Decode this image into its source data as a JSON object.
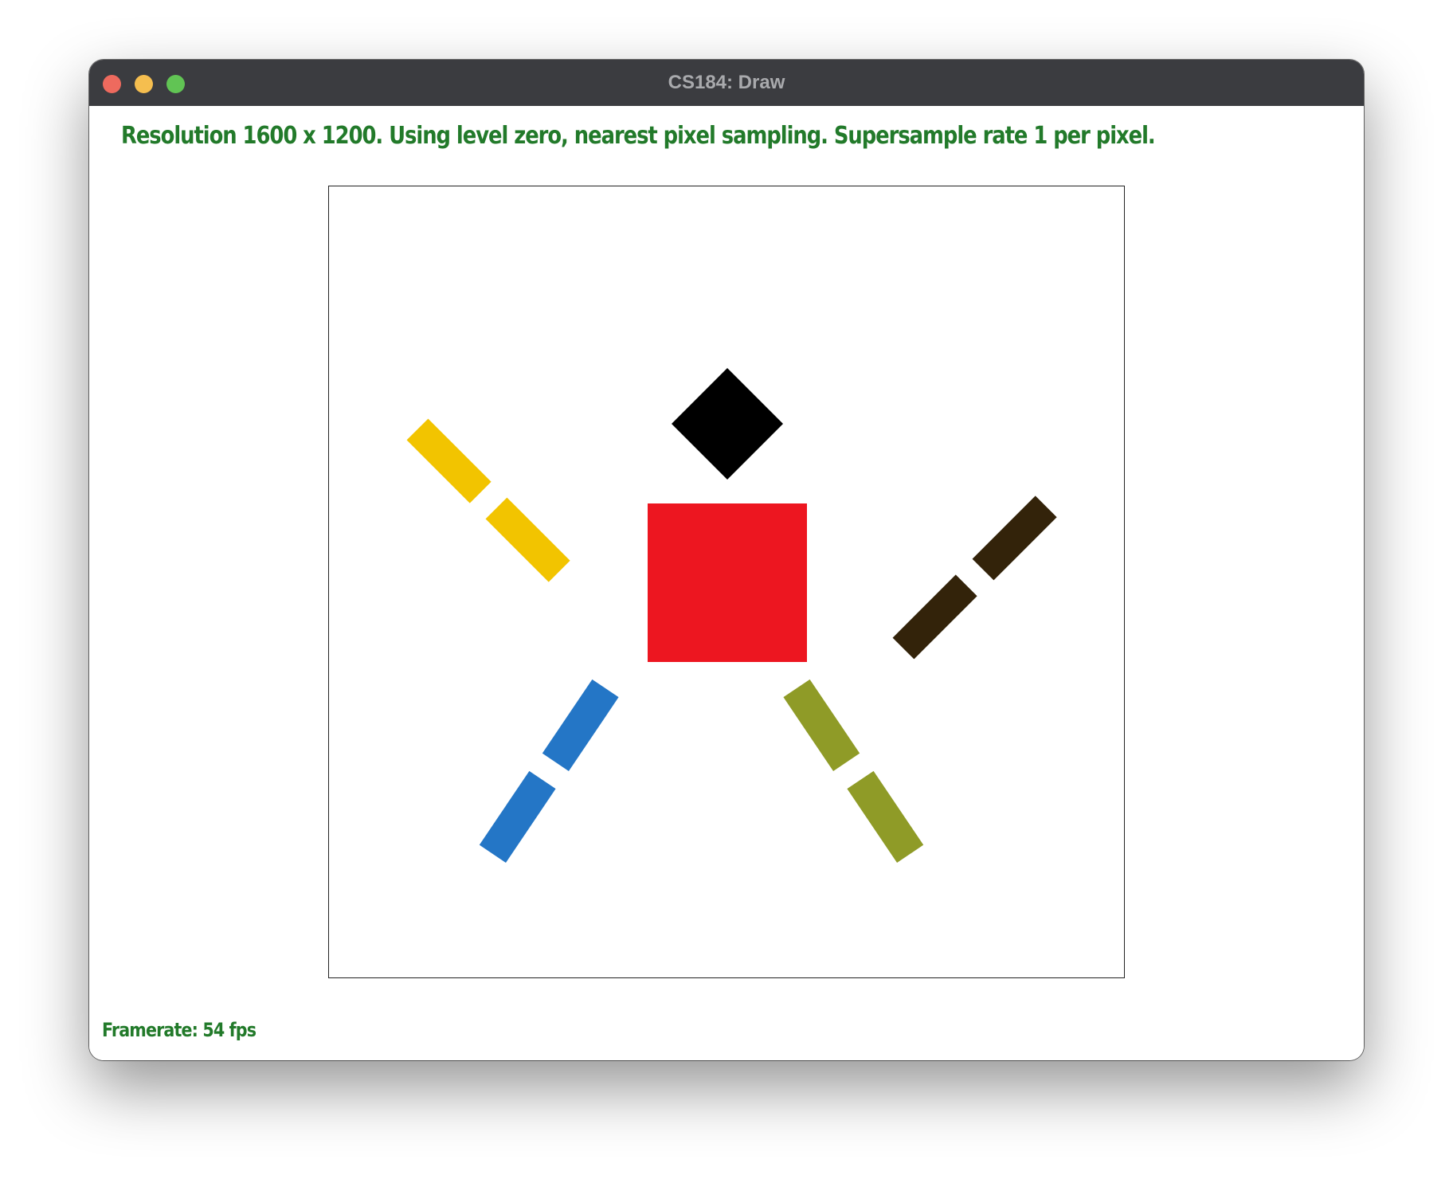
{
  "window": {
    "title": "CS184: Draw"
  },
  "status": {
    "text": "Resolution 1600 x 1200. Using level zero, nearest pixel sampling. Supersample rate 1 per pixel.",
    "color": "#227a2a"
  },
  "figure": {
    "head_color": "#000000",
    "body_color": "#ed1620",
    "left_arm_color": "#f2c400",
    "right_arm_color": "#33230a",
    "left_leg_color": "#2476c6",
    "right_leg_color": "#8f9b27"
  },
  "footer": {
    "framerate": "Framerate: 54 fps"
  }
}
